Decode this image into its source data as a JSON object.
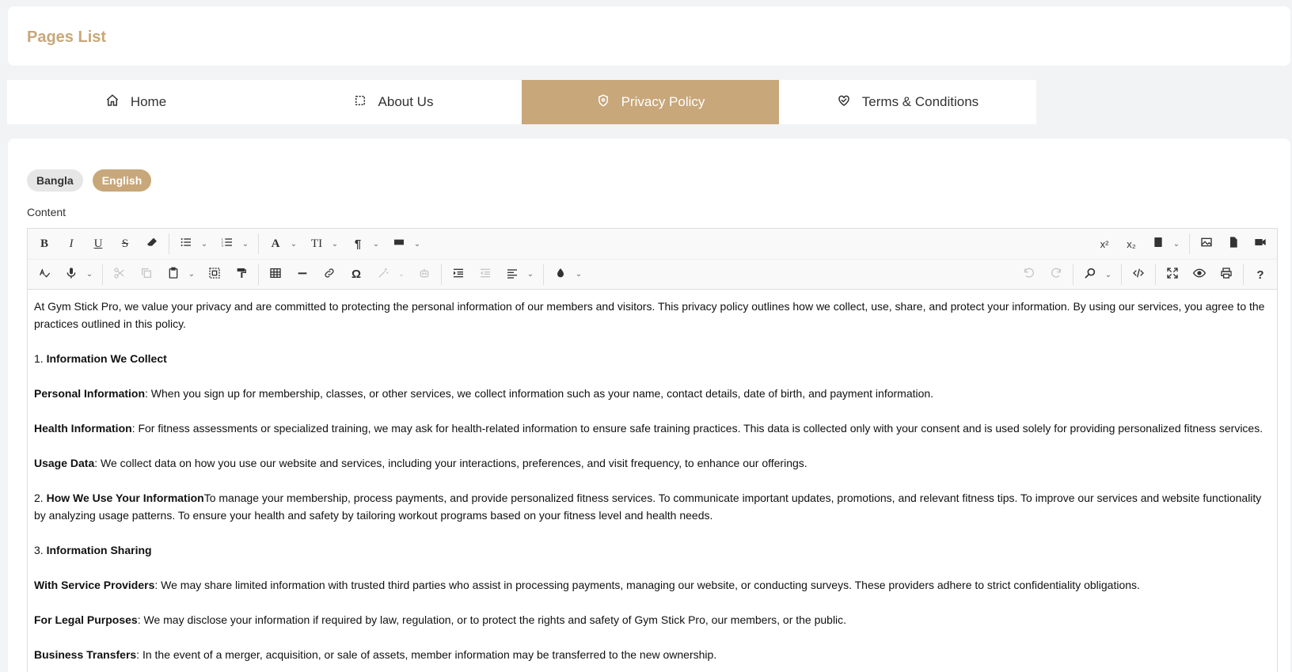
{
  "header": {
    "title": "Pages List"
  },
  "tabs": [
    {
      "label": "Home",
      "icon": "home-icon",
      "active": false
    },
    {
      "label": "About Us",
      "icon": "square-icon",
      "active": false
    },
    {
      "label": "Privacy Policy",
      "icon": "shield-icon",
      "active": true
    },
    {
      "label": "Terms & Conditions",
      "icon": "handshake-icon",
      "active": false
    }
  ],
  "languages": {
    "bangla": "Bangla",
    "english": "English",
    "selected": "English"
  },
  "content_label": "Content",
  "toolbar": {
    "bold": "B",
    "italic": "I",
    "underline": "U",
    "strike": "S",
    "font_color": "A",
    "font_size": "TI",
    "paragraph": "¶",
    "superscript": "x²",
    "subscript": "x₂",
    "special_char": "Ω",
    "help": "?"
  },
  "document": {
    "intro": "At Gym Stick Pro, we value your privacy and are committed to protecting the personal information of our members and visitors. This privacy policy outlines how we collect, use, share, and protect your information. By using our services, you agree to the practices outlined in this policy.",
    "s1_num": "1. ",
    "s1_title": "Information We Collect",
    "p1_label": "Personal Information",
    "p1_text": ": When you sign up for membership, classes, or other services, we collect information such as your name, contact details, date of birth, and payment information.",
    "p2_label": "Health Information",
    "p2_text": ": For fitness assessments or specialized training, we may ask for health-related information to ensure safe training practices. This data is collected only with your consent and is used solely for providing personalized fitness services.",
    "p3_label": "Usage Data",
    "p3_text": ": We collect data on how you use our website and services, including your interactions, preferences, and visit frequency, to enhance our offerings.",
    "s2_num": "2. ",
    "s2_title": "How We Use Your Information",
    "s2_text": "To manage your membership, process payments, and provide personalized fitness services. To communicate important updates, promotions, and relevant fitness tips. To improve our services and website functionality by analyzing usage patterns. To ensure your health and safety by tailoring workout programs based on your fitness level and health needs.",
    "s3_num": "3. ",
    "s3_title": "Information Sharing",
    "p4_label": "With Service Providers",
    "p4_text": ": We may share limited information with trusted third parties who assist in processing payments, managing our website, or conducting surveys. These providers adhere to strict confidentiality obligations.",
    "p5_label": "For Legal Purposes",
    "p5_text": ": We may disclose your information if required by law, regulation, or to protect the rights and safety of Gym Stick Pro, our members, or the public.",
    "p6_label": "Business Transfers",
    "p6_text": ": In the event of a merger, acquisition, or sale of assets, member information may be transferred to the new ownership."
  },
  "colors": {
    "accent": "#c8a77a",
    "background": "#f2f3f5"
  }
}
